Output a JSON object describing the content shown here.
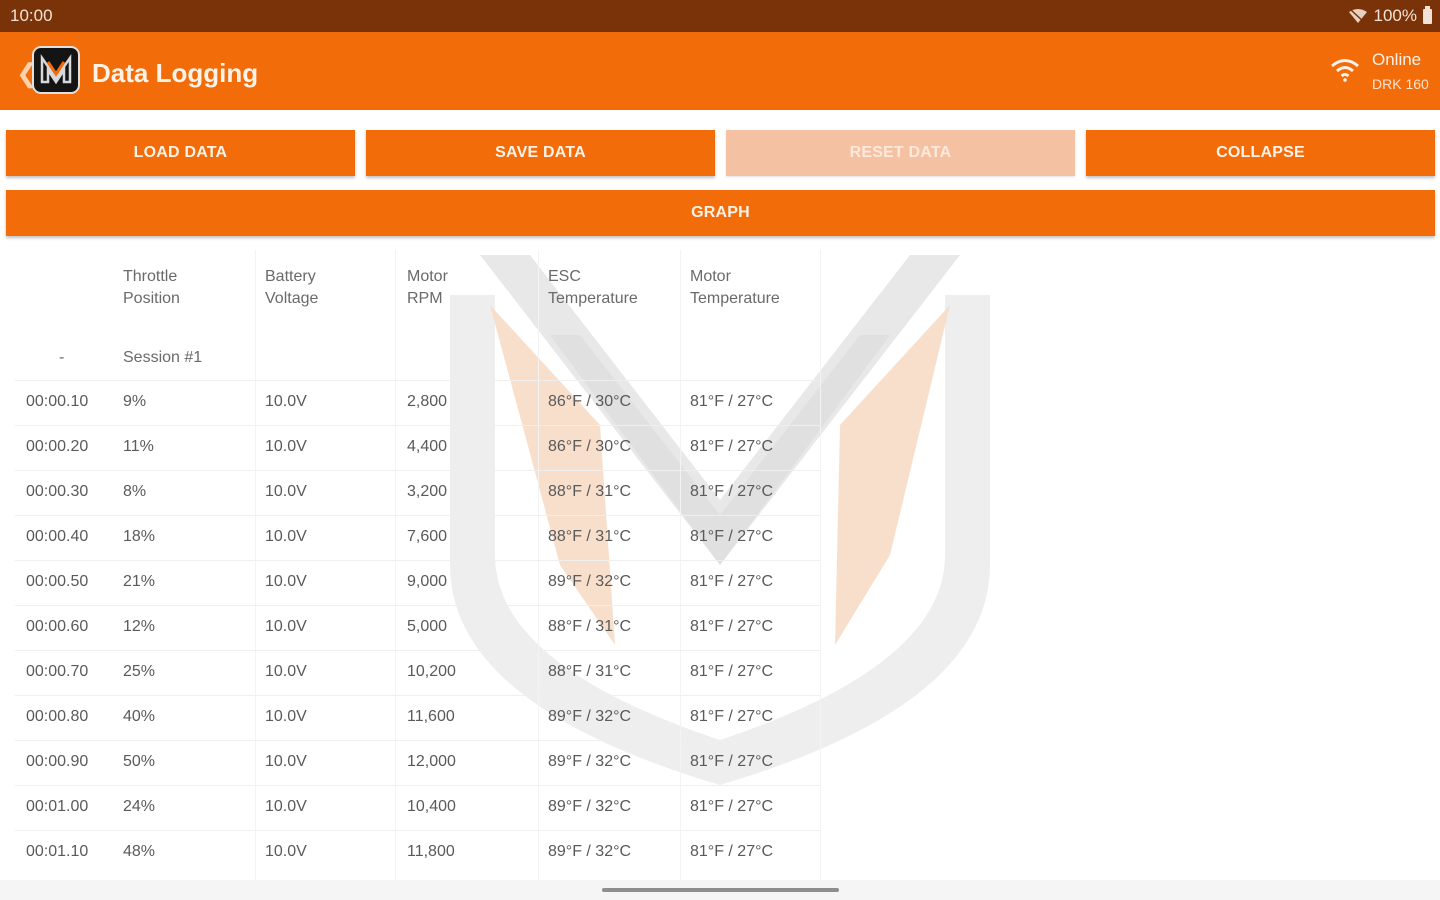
{
  "status_bar": {
    "time": "10:00",
    "battery": "100%"
  },
  "app_bar": {
    "title": "Data Logging",
    "connection_status": "Online",
    "device_name": "DRK 160"
  },
  "buttons": {
    "load": "LOAD DATA",
    "save": "SAVE DATA",
    "reset": "RESET DATA",
    "collapse": "COLLAPSE",
    "graph": "GRAPH"
  },
  "table": {
    "headers": {
      "throttle_1": "Throttle",
      "throttle_2": "Position",
      "battery_1": "Battery",
      "battery_2": "Voltage",
      "rpm_1": "Motor",
      "rpm_2": "RPM",
      "esc_1": "ESC",
      "esc_2": "Temperature",
      "motor_1": "Motor",
      "motor_2": "Temperature"
    },
    "session_marker": "-",
    "session_label": "Session #1",
    "rows": [
      {
        "time": "00:00.10",
        "throttle": "9%",
        "battery": "10.0V",
        "rpm": "2,800",
        "esc": "86°F / 30°C",
        "motor": "81°F / 27°C"
      },
      {
        "time": "00:00.20",
        "throttle": "11%",
        "battery": "10.0V",
        "rpm": "4,400",
        "esc": "86°F / 30°C",
        "motor": "81°F / 27°C"
      },
      {
        "time": "00:00.30",
        "throttle": "8%",
        "battery": "10.0V",
        "rpm": "3,200",
        "esc": "88°F / 31°C",
        "motor": "81°F / 27°C"
      },
      {
        "time": "00:00.40",
        "throttle": "18%",
        "battery": "10.0V",
        "rpm": "7,600",
        "esc": "88°F / 31°C",
        "motor": "81°F / 27°C"
      },
      {
        "time": "00:00.50",
        "throttle": "21%",
        "battery": "10.0V",
        "rpm": "9,000",
        "esc": "89°F / 32°C",
        "motor": "81°F / 27°C"
      },
      {
        "time": "00:00.60",
        "throttle": "12%",
        "battery": "10.0V",
        "rpm": "5,000",
        "esc": "88°F / 31°C",
        "motor": "81°F / 27°C"
      },
      {
        "time": "00:00.70",
        "throttle": "25%",
        "battery": "10.0V",
        "rpm": "10,200",
        "esc": "88°F / 31°C",
        "motor": "81°F / 27°C"
      },
      {
        "time": "00:00.80",
        "throttle": "40%",
        "battery": "10.0V",
        "rpm": "11,600",
        "esc": "89°F / 32°C",
        "motor": "81°F / 27°C"
      },
      {
        "time": "00:00.90",
        "throttle": "50%",
        "battery": "10.0V",
        "rpm": "12,000",
        "esc": "89°F / 32°C",
        "motor": "81°F / 27°C"
      },
      {
        "time": "00:01.00",
        "throttle": "24%",
        "battery": "10.0V",
        "rpm": "10,400",
        "esc": "89°F / 32°C",
        "motor": "81°F / 27°C"
      },
      {
        "time": "00:01.10",
        "throttle": "48%",
        "battery": "10.0V",
        "rpm": "11,800",
        "esc": "89°F / 32°C",
        "motor": "81°F / 27°C"
      }
    ]
  },
  "colors": {
    "accent": "#f26c0a",
    "status_bar": "#7a3208",
    "button_disabled": "#f4c2a2"
  },
  "icons": {
    "back": "chevron-left-icon",
    "logo": "app-logo-icon",
    "wifi": "wifi-icon",
    "battery": "battery-icon",
    "watermark": "brand-watermark"
  }
}
